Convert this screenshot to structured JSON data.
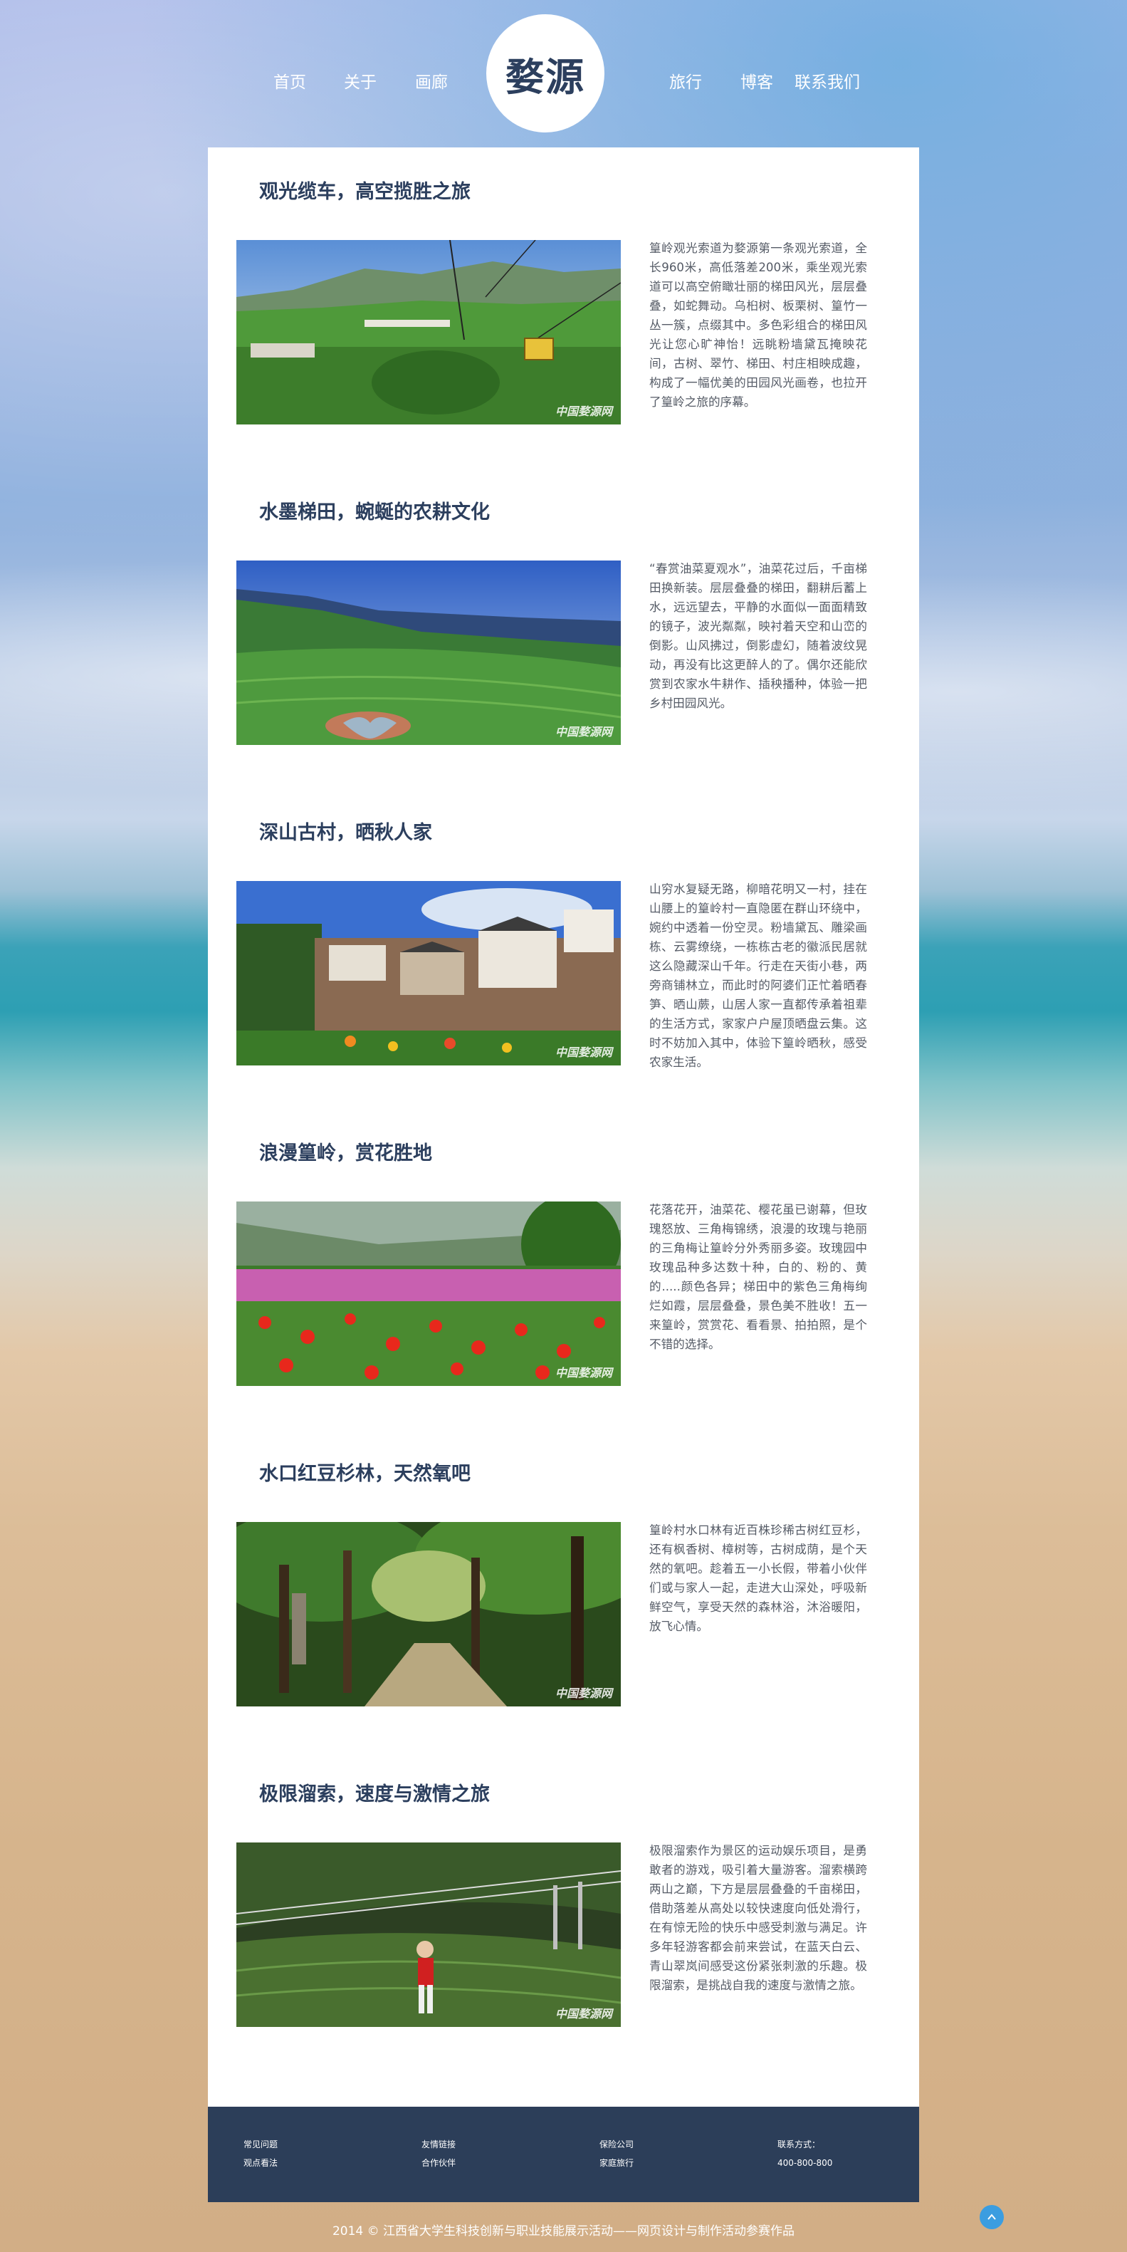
{
  "nav": {
    "left": [
      "首页",
      "关于",
      "画廊"
    ],
    "logo": "婺源",
    "right": [
      "旅行",
      "博客",
      "联系我们"
    ]
  },
  "sections": [
    {
      "title": "观光缆车，高空揽胜之旅",
      "text": "篁岭观光索道为婺源第一条观光索道，全长960米，高低落差200米，乘坐观光索道可以高空俯瞰壮丽的梯田风光，层层叠叠，如蛇舞动。乌桕树、板栗树、篁竹一丛一簇，点缀其中。多色彩组合的梯田风光让您心旷神怡！远眺粉墙黛瓦掩映花间，古树、翠竹、梯田、村庄相映成趣，构成了一幅优美的田园风光画卷，也拉开了篁岭之旅的序幕。",
      "watermark": "中国婺源网"
    },
    {
      "title": "水墨梯田，蜿蜒的农耕文化",
      "text": "“春赏油菜夏观水”，油菜花过后，千亩梯田换新装。层层叠叠的梯田，翻耕后蓄上水，远远望去，平静的水面似一面面精致的镜子，波光粼粼，映衬着天空和山峦的倒影。山风拂过，倒影虚幻，随着波纹晃动，再没有比这更醉人的了。偶尔还能欣赏到农家水牛耕作、插秧播种，体验一把乡村田园风光。",
      "watermark": "中国婺源网"
    },
    {
      "title": "深山古村，晒秋人家",
      "text": "山穷水复疑无路，柳暗花明又一村，挂在山腰上的篁岭村一直隐匿在群山环绕中，婉约中透着一份空灵。粉墙黛瓦、雕梁画栋、云雾缭绕，一栋栋古老的徽派民居就这么隐藏深山千年。行走在天街小巷，两旁商铺林立，而此时的阿婆们正忙着晒春笋、晒山蕨，山居人家一直都传承着祖辈的生活方式，家家户户屋顶晒盘云集。这时不妨加入其中，体验下篁岭晒秋，感受农家生活。",
      "watermark": "中国婺源网"
    },
    {
      "title": "浪漫篁岭，赏花胜地",
      "text": "花落花开，油菜花、樱花虽已谢幕，但玫瑰怒放、三角梅锦绣，浪漫的玫瑰与艳丽的三角梅让篁岭分外秀丽多姿。玫瑰园中玫瑰品种多达数十种，白的、粉的、黄的.....颜色各异；梯田中的紫色三角梅绚烂如霞，层层叠叠，景色美不胜收！五一来篁岭，赏赏花、看看景、拍拍照，是个不错的选择。",
      "watermark": "中国婺源网"
    },
    {
      "title": "水口红豆杉林，天然氧吧",
      "text": "篁岭村水口林有近百株珍稀古树红豆杉，还有枫香树、樟树等，古树成荫，是个天然的氧吧。趁着五一小长假，带着小伙伴们或与家人一起，走进大山深处，呼吸新鲜空气，享受天然的森林浴，沐浴暖阳，放飞心情。",
      "watermark": "中国婺源网"
    },
    {
      "title": "极限溜索，速度与激情之旅",
      "text": "极限溜索作为景区的运动娱乐项目，是勇敢者的游戏，吸引着大量游客。溜索横跨两山之巅，下方是层层叠叠的千亩梯田，借助落差从高处以较快速度向低处滑行，在有惊无险的快乐中感受刺激与满足。许多年轻游客都会前来尝试，在蓝天白云、青山翠岚间感受这份紧张刺激的乐趣。极限溜索，是挑战自我的速度与激情之旅。",
      "watermark": "中国婺源网"
    }
  ],
  "footer": {
    "columns": [
      {
        "items": [
          "常见问题",
          "观点看法"
        ]
      },
      {
        "items": [
          "友情链接",
          "合作伙伴"
        ]
      },
      {
        "items": [
          "保险公司",
          "家庭旅行"
        ]
      },
      {
        "items": [
          "联系方式：",
          "400-800-800"
        ]
      }
    ],
    "copyright": "2014 © 江西省大学生科技创新与职业技能展示活动——网页设计与制作活动参赛作品"
  },
  "colors": {
    "accent": "#2c3e59",
    "title": "#2c3f5e",
    "back_to_top": "#3b9de0"
  },
  "icons": {
    "back_to_top": "chevron-up-icon"
  }
}
